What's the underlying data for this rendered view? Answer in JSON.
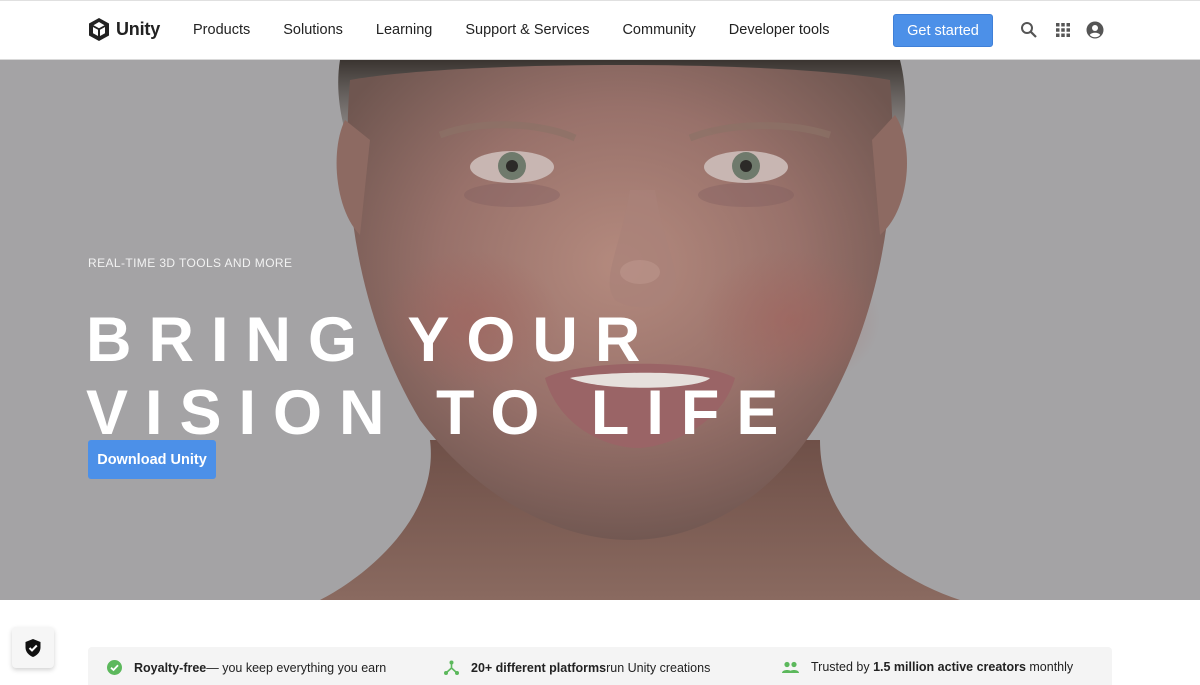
{
  "header": {
    "logo_text": "Unity",
    "nav": [
      "Products",
      "Solutions",
      "Learning",
      "Support & Services",
      "Community",
      "Developer tools"
    ],
    "cta_label": "Get started",
    "icons": [
      "search-icon",
      "apps-grid-icon",
      "account-icon"
    ]
  },
  "hero": {
    "eyebrow": "REAL-TIME 3D TOOLS AND MORE",
    "headline_line1": "BRING YOUR",
    "headline_line2": "VISION TO LIFE",
    "button_label": "Download Unity"
  },
  "features": [
    {
      "icon": "check-circle-icon",
      "bold": "Royalty-free",
      "text": " — you keep everything you earn"
    },
    {
      "icon": "platforms-icon",
      "bold": "20+ different platforms",
      "text": " run Unity creations"
    },
    {
      "icon": "people-icon",
      "prefix": "Trusted by ",
      "bold": "1.5 million active creators",
      "text": " monthly"
    }
  ],
  "privacy_icon": "shield-check-icon",
  "colors": {
    "accent": "#4c90e8",
    "feature_icon": "#5cb85c",
    "hero_bg": "#a4a3a5"
  }
}
